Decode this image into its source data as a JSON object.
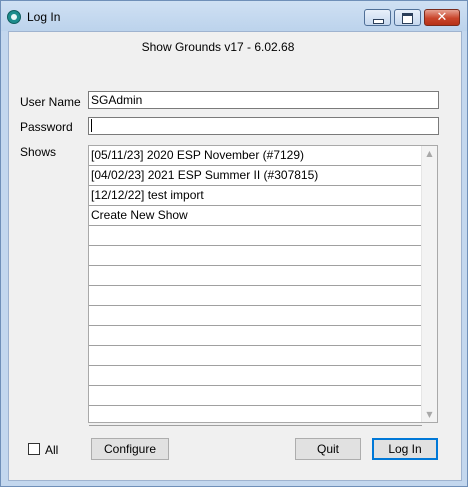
{
  "window": {
    "title": "Log In",
    "controls": {
      "minimize_icon": "minimize-icon",
      "maximize_icon": "maximize-icon",
      "close_glyph": "✕"
    }
  },
  "app_version": "Show Grounds v17 - 6.02.68",
  "form": {
    "username_label": "User Name",
    "username_value": "SGAdmin",
    "password_label": "Password",
    "password_value": "",
    "shows_label": "Shows"
  },
  "shows": [
    "[05/11/23] 2020 ESP November (#7129)",
    "[04/02/23] 2021 ESP Summer II (#307815)",
    "[12/12/22] test import",
    "Create New Show",
    "",
    "",
    "",
    "",
    "",
    "",
    "",
    "",
    "",
    ""
  ],
  "scroll": {
    "up_arrow": "▲",
    "down_arrow": "▼"
  },
  "footer": {
    "all_label": "All",
    "all_checked": false,
    "configure_label": "Configure",
    "quit_label": "Quit",
    "login_label": "Log In"
  },
  "colors": {
    "title_bar": "#c3d7ee",
    "close_button": "#c9452b",
    "default_button_border": "#0078d7"
  }
}
